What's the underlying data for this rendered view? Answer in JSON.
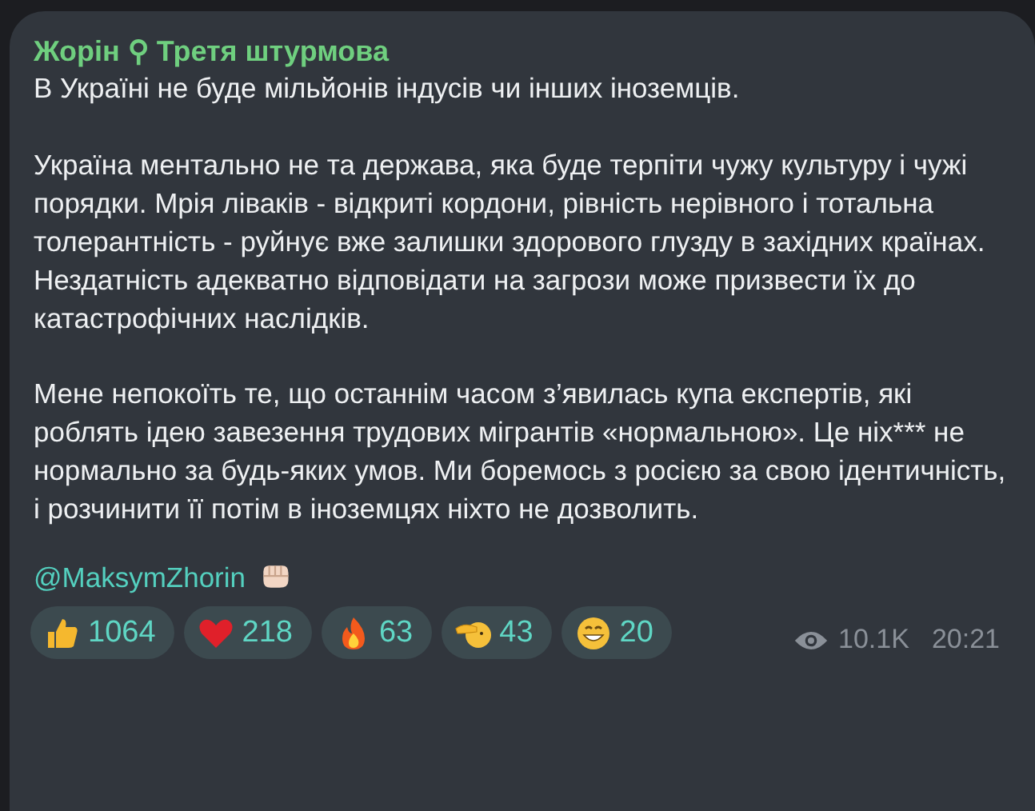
{
  "message": {
    "author": "Жорін ⚲ Третя штурмова",
    "paragraphs": [
      "В Україні не буде мільйонів індусів чи інших іноземців.",
      "Україна ментально не та держава, яка буде терпіти чужу культуру і чужі порядки. Мрія ліваків - відкриті кордони, рівність нерівного і тотальна толерантність - руйнує вже залишки здорового глузду в західних країнах. Нездатність адекватно відповідати на загрози може призвести їх до катастрофічних наслідків.",
      "Мене непокоїть те, що останнім часом з’явилась купа експертів, які роблять ідею завезення трудових мігрантів «нормальною». Це ніх*** не нормально за будь-яких умов. Ми боремось з росією за свою ідентичність, і розчинити її потім в іноземцях ніхто не дозволить."
    ],
    "signature": "@MaksymZhorin",
    "reactions": [
      {
        "kind": "thumbs",
        "count": "1064"
      },
      {
        "kind": "heart",
        "count": "218"
      },
      {
        "kind": "fire",
        "count": "63"
      },
      {
        "kind": "salute",
        "count": "43"
      },
      {
        "kind": "grin",
        "count": "20"
      }
    ],
    "views": "10.1K",
    "time": "20:21"
  }
}
